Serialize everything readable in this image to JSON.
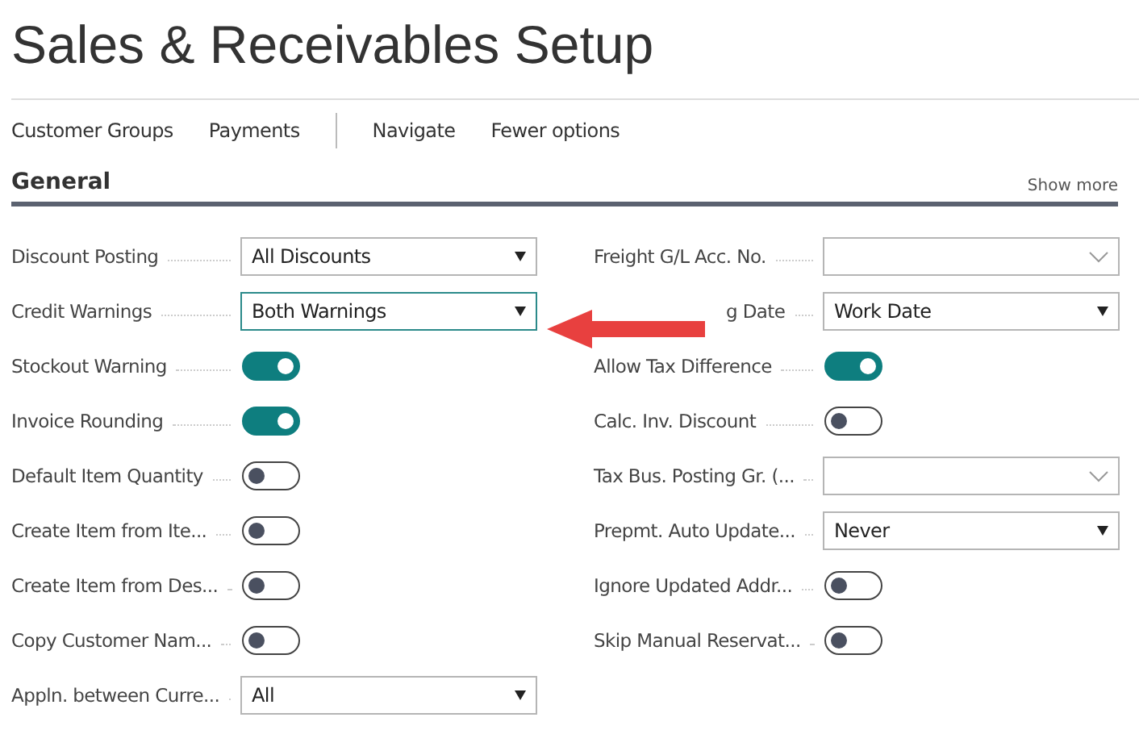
{
  "title": "Sales & Receivables Setup",
  "action_groups": [
    [
      "Customer Groups",
      "Payments"
    ],
    [
      "Navigate",
      "Fewer options"
    ]
  ],
  "section": {
    "title": "General",
    "more": "Show more"
  },
  "columns": [
    [
      {
        "label": "Discount Posting",
        "kind": "select",
        "value": "All Discounts",
        "focused": false
      },
      {
        "label": "Credit Warnings",
        "kind": "select",
        "value": "Both Warnings",
        "focused": true
      },
      {
        "label": "Stockout Warning",
        "kind": "toggle",
        "on": true
      },
      {
        "label": "Invoice Rounding",
        "kind": "toggle",
        "on": true
      },
      {
        "label": "Default Item Quantity",
        "kind": "toggle",
        "on": false
      },
      {
        "label": "Create Item from Ite...",
        "kind": "toggle",
        "on": false
      },
      {
        "label": "Create Item from Des...",
        "kind": "toggle",
        "on": false
      },
      {
        "label": "Copy Customer Nam...",
        "kind": "toggle",
        "on": false
      },
      {
        "label": "Appln. between Curre...",
        "kind": "select",
        "value": "All",
        "focused": false
      }
    ],
    [
      {
        "label": "Freight G/L Acc. No.",
        "kind": "lookup"
      },
      {
        "label": "g Date",
        "kind": "select",
        "value": "Work Date",
        "focused": false,
        "covered": true
      },
      {
        "label": "Allow Tax Difference",
        "kind": "toggle",
        "on": true
      },
      {
        "label": "Calc. Inv. Discount",
        "kind": "toggle",
        "on": false
      },
      {
        "label": "Tax Bus. Posting Gr. (...",
        "kind": "lookup"
      },
      {
        "label": "Prepmt. Auto Update...",
        "kind": "select",
        "value": "Never",
        "focused": false
      },
      {
        "label": "Ignore Updated Addr...",
        "kind": "toggle",
        "on": false
      },
      {
        "label": "Skip Manual Reservat...",
        "kind": "toggle",
        "on": false
      }
    ]
  ]
}
